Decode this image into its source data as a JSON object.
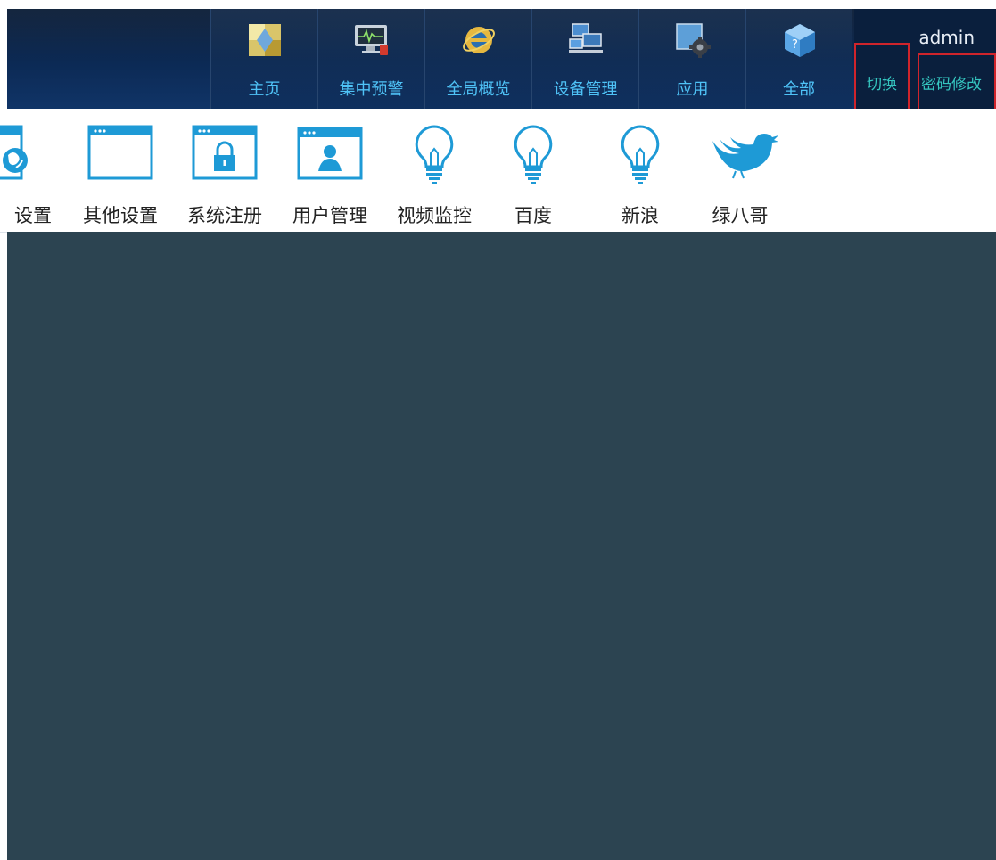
{
  "header": {
    "nav": [
      {
        "label": "主页",
        "icon": "home-puzzle-icon"
      },
      {
        "label": "集中预警",
        "icon": "monitor-warning-icon"
      },
      {
        "label": "全局概览",
        "icon": "ie-globe-icon"
      },
      {
        "label": "设备管理",
        "icon": "devices-icon"
      },
      {
        "label": "应用",
        "icon": "app-gear-icon"
      },
      {
        "label": "全部",
        "icon": "cube-help-icon"
      }
    ],
    "user": {
      "name": "admin",
      "switch_label": "切换",
      "password_label": "密码修改"
    }
  },
  "toolbar": {
    "items": [
      {
        "label": "设置",
        "icon": "browser-globe-icon"
      },
      {
        "label": "其他设置",
        "icon": "browser-window-icon"
      },
      {
        "label": "系统注册",
        "icon": "browser-lock-icon"
      },
      {
        "label": "用户管理",
        "icon": "browser-user-icon"
      },
      {
        "label": "视频监控",
        "icon": "lightbulb-icon"
      },
      {
        "label": "百度",
        "icon": "lightbulb-icon"
      },
      {
        "label": "新浪",
        "icon": "lightbulb-icon"
      },
      {
        "label": "绿八哥",
        "icon": "bird-icon"
      }
    ]
  },
  "colors": {
    "header_bg": "#0c2a55",
    "nav_text": "#4fc3f7",
    "link_text": "#35c6c0",
    "highlight_border": "#d0242b",
    "icon_blue": "#1e9ad6",
    "content_bg": "#2c4451"
  }
}
